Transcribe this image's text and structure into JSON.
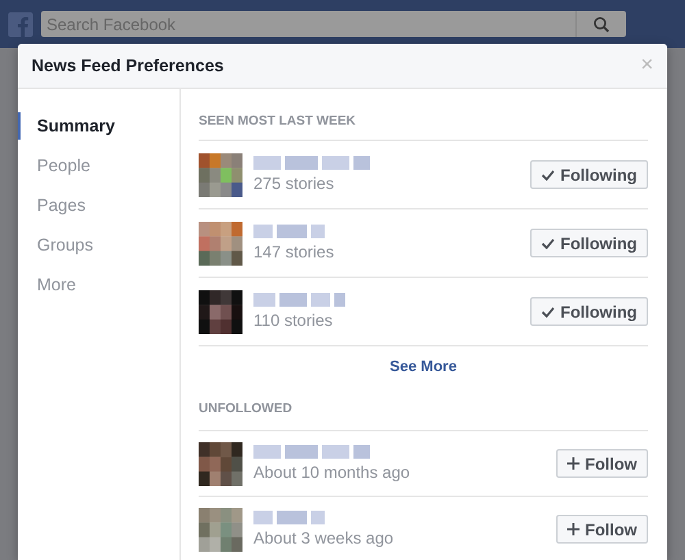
{
  "topbar": {
    "search_placeholder": "Search Facebook"
  },
  "dialog": {
    "title": "News Feed Preferences",
    "close": "×"
  },
  "sidebar": {
    "items": [
      {
        "label": "Summary",
        "selected": true
      },
      {
        "label": "People",
        "selected": false
      },
      {
        "label": "Pages",
        "selected": false
      },
      {
        "label": "Groups",
        "selected": false
      },
      {
        "label": "More",
        "selected": false
      }
    ]
  },
  "sections": [
    {
      "heading": "SEEN MOST LAST WEEK",
      "rows": [
        {
          "detail": "275 stories",
          "button": {
            "kind": "following",
            "label": "Following"
          }
        },
        {
          "detail": "147 stories",
          "button": {
            "kind": "following",
            "label": "Following"
          }
        },
        {
          "detail": "110 stories",
          "button": {
            "kind": "following",
            "label": "Following"
          }
        }
      ],
      "see_more": "See More"
    },
    {
      "heading": "UNFOLLOWED",
      "rows": [
        {
          "detail": "About 10 months ago",
          "button": {
            "kind": "follow",
            "label": "Follow"
          }
        },
        {
          "detail": "About 3 weeks ago",
          "button": {
            "kind": "follow",
            "label": "Follow"
          }
        }
      ]
    }
  ]
}
